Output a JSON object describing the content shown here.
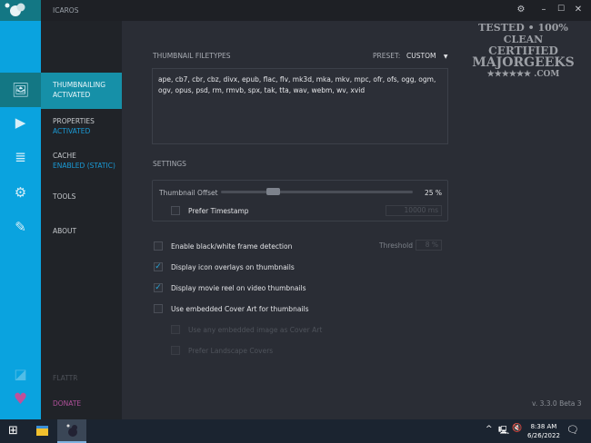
{
  "app": {
    "title": "ICAROS",
    "version": "v. 3.3.0 Beta 3"
  },
  "rail_icons": [
    "image-icon",
    "video-play-icon",
    "cache-stack-icon",
    "gear-icon",
    "pen-icon",
    "flattr-icon",
    "heart-icon"
  ],
  "nav": [
    {
      "label": "THUMBNAILING",
      "status": "ACTIVATED",
      "selected": true
    },
    {
      "label": "PROPERTIES",
      "status": "ACTIVATED"
    },
    {
      "label": "CACHE",
      "status": "ENABLED (STATIC)"
    },
    {
      "label": "TOOLS",
      "status": ""
    },
    {
      "label": "ABOUT",
      "status": ""
    },
    {
      "label": "FLATTR",
      "status": ""
    },
    {
      "label": "DONATE",
      "status": ""
    }
  ],
  "filetypes": {
    "heading": "THUMBNAIL FILETYPES",
    "preset_label": "PRESET:",
    "preset_value": "CUSTOM",
    "list": "ape, cb7, cbr, cbz, divx, epub, flac, flv, mk3d, mka, mkv, mpc, ofr, ofs, ogg, ogm, ogv, opus, psd, rm, rmvb, spx, tak, tta, wav, webm, wv, xvid"
  },
  "settings": {
    "heading": "SETTINGS",
    "offset_label": "Thumbnail Offset",
    "offset_value": "25 %",
    "offset_percent": 25,
    "prefer_timestamp": "Prefer Timestamp",
    "timestamp_value": "10000 ms",
    "options": [
      {
        "label": "Enable black/white frame detection",
        "checked": false
      },
      {
        "label": "Display icon overlays on thumbnails",
        "checked": true
      },
      {
        "label": "Display movie reel on video thumbnails",
        "checked": true
      },
      {
        "label": "Use embedded Cover Art for thumbnails",
        "checked": false
      },
      {
        "label": "Use any embedded image as Cover Art",
        "checked": false,
        "disabled": true
      },
      {
        "label": "Prefer Landscape Covers",
        "checked": false,
        "disabled": true
      }
    ],
    "threshold_label": "Threshold",
    "threshold_value": "8 %"
  },
  "watermark": {
    "line1": "TESTED • 100% CLEAN",
    "line2": "CERTIFIED",
    "line3": "MAJORGEEKS",
    "line4": "★★★★★★ .COM"
  },
  "taskbar": {
    "time": "8:38 AM",
    "date": "6/26/2022"
  },
  "colors": {
    "accent": "#0aa3df",
    "selected": "#1690a8",
    "donate": "#c0509a"
  }
}
